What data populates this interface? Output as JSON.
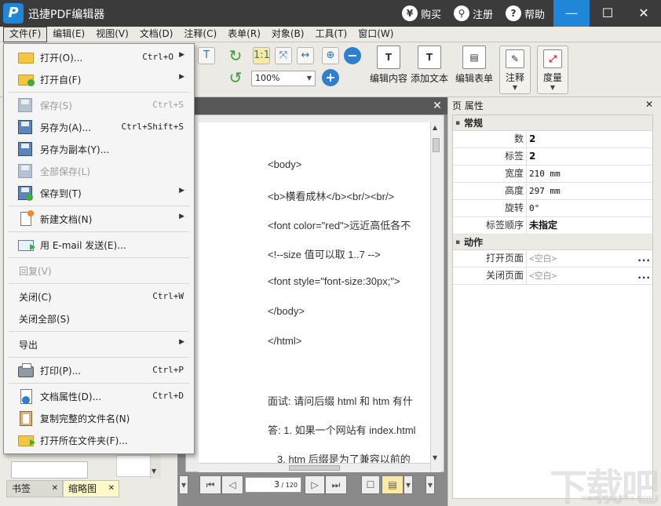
{
  "window": {
    "title": "迅捷PDF编辑器",
    "logo_letter": "P",
    "buy_label": "购买",
    "register_label": "注册",
    "help_label": "帮助",
    "buy_glyph": "¥",
    "help_glyph": "?",
    "minimize_glyph": "—",
    "maximize_glyph": "☐",
    "close_glyph": "✕"
  },
  "menubar": [
    {
      "label": "文件(F)"
    },
    {
      "label": "编辑(E)"
    },
    {
      "label": "视图(V)"
    },
    {
      "label": "文档(D)"
    },
    {
      "label": "注释(C)"
    },
    {
      "label": "表单(R)"
    },
    {
      "label": "对象(B)"
    },
    {
      "label": "工具(T)"
    },
    {
      "label": "窗口(W)"
    }
  ],
  "toolbar": {
    "zoom_value": "100%",
    "edit_content": "编辑内容",
    "add_text": "添加文本",
    "edit_form": "编辑表单",
    "annotate": "注释",
    "measure": "度量",
    "icons": [
      "actual-size-icon",
      "fit-page-icon",
      "fit-width-icon",
      "zoom-in-icon",
      "zoom-out-icon",
      "rotate-cw-icon",
      "rotate-ccw-icon",
      "zoom-plus-icon"
    ]
  },
  "file_menu": {
    "items": [
      {
        "label": "打开(O)...",
        "shortcut": "Ctrl+O",
        "submenu": true,
        "disabled": false
      },
      {
        "label": "打开自(F)",
        "shortcut": "",
        "submenu": true,
        "disabled": false
      },
      {
        "label": "保存(S)",
        "shortcut": "Ctrl+S",
        "submenu": false,
        "disabled": true
      },
      {
        "label": "另存为(A)...",
        "shortcut": "Ctrl+Shift+S",
        "submenu": false,
        "disabled": false
      },
      {
        "label": "另存为副本(Y)...",
        "shortcut": "",
        "submenu": false,
        "disabled": false
      },
      {
        "label": "全部保存(L)",
        "shortcut": "",
        "submenu": false,
        "disabled": true
      },
      {
        "label": "保存到(T)",
        "shortcut": "",
        "submenu": true,
        "disabled": false
      },
      {
        "label": "新建文档(N)",
        "shortcut": "",
        "submenu": true,
        "disabled": false
      },
      {
        "label": "用 E-mail 发送(E)...",
        "shortcut": "",
        "submenu": false,
        "disabled": false
      },
      {
        "label": "回复(V)",
        "shortcut": "",
        "submenu": false,
        "disabled": true
      },
      {
        "label": "关闭(C)",
        "shortcut": "Ctrl+W",
        "submenu": false,
        "disabled": false
      },
      {
        "label": "关闭全部(S)",
        "shortcut": "",
        "submenu": false,
        "disabled": false
      },
      {
        "label": "导出",
        "shortcut": "",
        "submenu": true,
        "disabled": false
      },
      {
        "label": "打印(P)...",
        "shortcut": "Ctrl+P",
        "submenu": false,
        "disabled": false
      },
      {
        "label": "文档属性(D)...",
        "shortcut": "Ctrl+D",
        "submenu": false,
        "disabled": false
      },
      {
        "label": "复制完整的文件名(N)",
        "shortcut": "",
        "submenu": false,
        "disabled": false
      },
      {
        "label": "打开所在文件夹(F)...",
        "shortcut": "",
        "submenu": false,
        "disabled": false
      }
    ],
    "submenu_glyph": "▶"
  },
  "document": {
    "lines": [
      "<body>",
      "<b>横看成林</b><br/><br/>",
      "<font color=\"red\">远近高低各不",
      "<!--size 值可以取 1..7 -->",
      "<font style=\"font-size:30px;\">",
      "</body>",
      "</html>",
      "面试: 请问后缀 html 和 htm 有什",
      "答: 1. 如果一个网站有 index.html",
      "3. htm 后缀是为了兼容以前的"
    ],
    "close_glyph": "✕"
  },
  "navigation": {
    "page_current": "3",
    "page_total": "120",
    "first_glyph": "⏮",
    "prev_glyph": "◁",
    "next_glyph": "▷",
    "last_glyph": "⏭",
    "layout_glyph": "☐"
  },
  "left_panel": {
    "tabs": [
      {
        "label": "书签",
        "active": false
      },
      {
        "label": "缩略图",
        "active": true
      }
    ],
    "close_glyph": "✕"
  },
  "properties": {
    "title": "页 属性",
    "close_glyph": "✕",
    "sections": [
      {
        "name": "常规",
        "rows": [
          {
            "key": "数",
            "value": "2",
            "style": "bold"
          },
          {
            "key": "标签",
            "value": "2",
            "style": "bold"
          },
          {
            "key": "宽度",
            "value": "210 mm",
            "style": "mono"
          },
          {
            "key": "高度",
            "value": "297 mm",
            "style": "mono"
          },
          {
            "key": "旋转",
            "value": "0°",
            "style": "mono"
          },
          {
            "key": "标签顺序",
            "value": "未指定",
            "style": "bold"
          }
        ]
      },
      {
        "name": "动作",
        "rows": [
          {
            "key": "打开页面",
            "value": "<空白>",
            "style": "gray",
            "dots": "..."
          },
          {
            "key": "关闭页面",
            "value": "<空白>",
            "style": "gray",
            "dots": "..."
          }
        ]
      }
    ]
  },
  "watermark": {
    "text": "下载吧",
    "sub": "www.xiazaiba.com"
  }
}
